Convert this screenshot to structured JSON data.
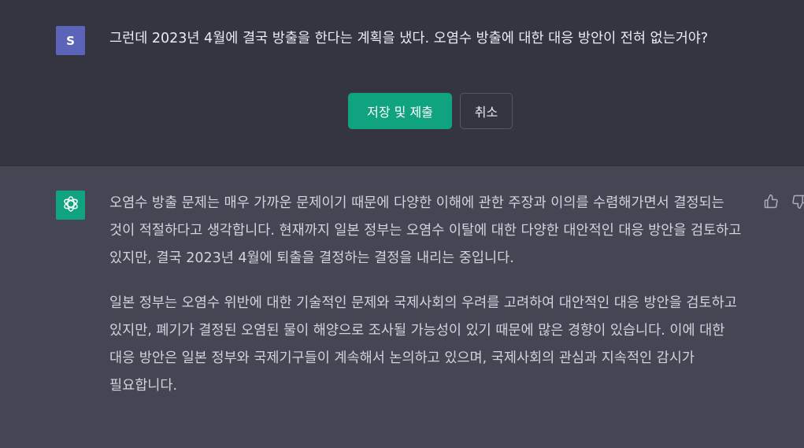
{
  "user_message": {
    "avatar_initial": "S",
    "text": "그런데 2023년 4월에 결국 방출을 한다는 계획을 냈다. 오염수 방출에 대한 대응 방안이 전혀 없는거야?"
  },
  "edit_actions": {
    "save_label": "저장 및 제출",
    "cancel_label": "취소"
  },
  "assistant_message": {
    "paragraphs": [
      "오염수 방출 문제는 매우 가까운 문제이기 때문에 다양한 이해에 관한 주장과 이의를 수렴해가면서 결정되는 것이 적절하다고 생각합니다. 현재까지 일본 정부는 오염수 이탈에 대한 다양한 대안적인 대응 방안을 검토하고 있지만, 결국 2023년 4월에 퇴출을 결정하는 결정을 내리는 중입니다.",
      "일본 정부는 오염수 위반에 대한 기술적인 문제와 국제사회의 우려를 고려하여 대안적인 대응 방안을 검토하고 있지만, 폐기가 결정된 오염된 물이 해양으로 조사될 가능성이 있기 때문에 많은 경향이 있습니다. 이에 대한 대응 방안은 일본 정부와 국제기구들이 계속해서 논의하고 있으며, 국제사회의 관심과 지속적인 감시가 필요합니다."
    ]
  },
  "icons": {
    "assistant_avatar": "openai-logo-icon",
    "like": "thumbs-up-icon",
    "dislike": "thumbs-down-icon"
  },
  "colors": {
    "user_bg": "#343541",
    "assistant_bg": "#444654",
    "accent": "#10a37f",
    "user_avatar": "#5b64b8"
  }
}
